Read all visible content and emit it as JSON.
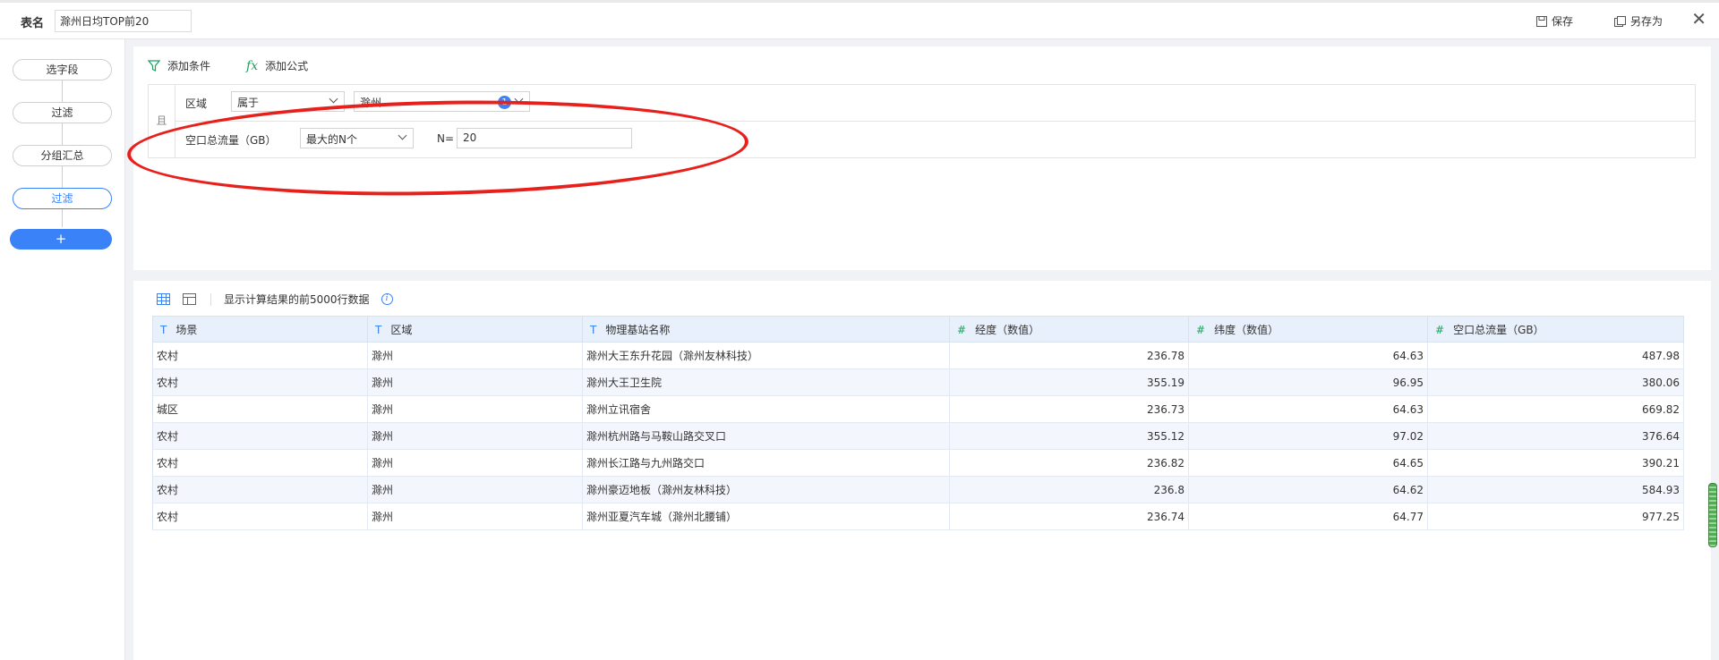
{
  "header": {
    "table_name_label": "表名",
    "table_name_value": "滁州日均TOP前20",
    "save_label": "保存",
    "save_as_label": "另存为"
  },
  "steps": {
    "items": [
      {
        "label": "选字段",
        "active": false
      },
      {
        "label": "过滤",
        "active": false
      },
      {
        "label": "分组汇总",
        "active": false
      },
      {
        "label": "过滤",
        "active": true
      }
    ],
    "add_label": "+"
  },
  "filter": {
    "add_condition_label": "添加条件",
    "add_formula_label": "添加公式",
    "add_formula_icon_text": "fx",
    "logic_label": "且",
    "conditions": [
      {
        "field": "区域",
        "operator": "属于",
        "value": "滁州",
        "badge": "1"
      },
      {
        "field": "空口总流量（GB）",
        "operator": "最大的N个",
        "n_label": "N=",
        "n_value": "20"
      }
    ]
  },
  "data_view": {
    "info_text": "显示计算结果的前5000行数据",
    "columns": [
      {
        "type": "T",
        "name": "场景"
      },
      {
        "type": "T",
        "name": "区域"
      },
      {
        "type": "T",
        "name": "物理基站名称"
      },
      {
        "type": "#",
        "name": "经度（数值）"
      },
      {
        "type": "#",
        "name": "纬度（数值）"
      },
      {
        "type": "#",
        "name": "空口总流量（GB）"
      }
    ],
    "rows": [
      [
        "农村",
        "滁州",
        "滁州大王东升花园（滁州友林科技）",
        "236.78",
        "64.63",
        "487.98"
      ],
      [
        "农村",
        "滁州",
        "滁州大王卫生院",
        "355.19",
        "96.95",
        "380.06"
      ],
      [
        "城区",
        "滁州",
        "滁州立讯宿舍",
        "236.73",
        "64.63",
        "669.82"
      ],
      [
        "农村",
        "滁州",
        "滁州杭州路与马鞍山路交叉口",
        "355.12",
        "97.02",
        "376.64"
      ],
      [
        "农村",
        "滁州",
        "滁州长江路与九州路交口",
        "236.82",
        "64.65",
        "390.21"
      ],
      [
        "农村",
        "滁州",
        "滁州豪迈地板（滁州友林科技）",
        "236.8",
        "64.62",
        "584.93"
      ],
      [
        "农村",
        "滁州",
        "滁州亚夏汽车城（滁州北腰铺）",
        "236.74",
        "64.77",
        "977.25"
      ]
    ]
  },
  "colors": {
    "accent": "#3a82f7",
    "numeric_type": "#1aa35d",
    "annotation": "#e8201c"
  }
}
